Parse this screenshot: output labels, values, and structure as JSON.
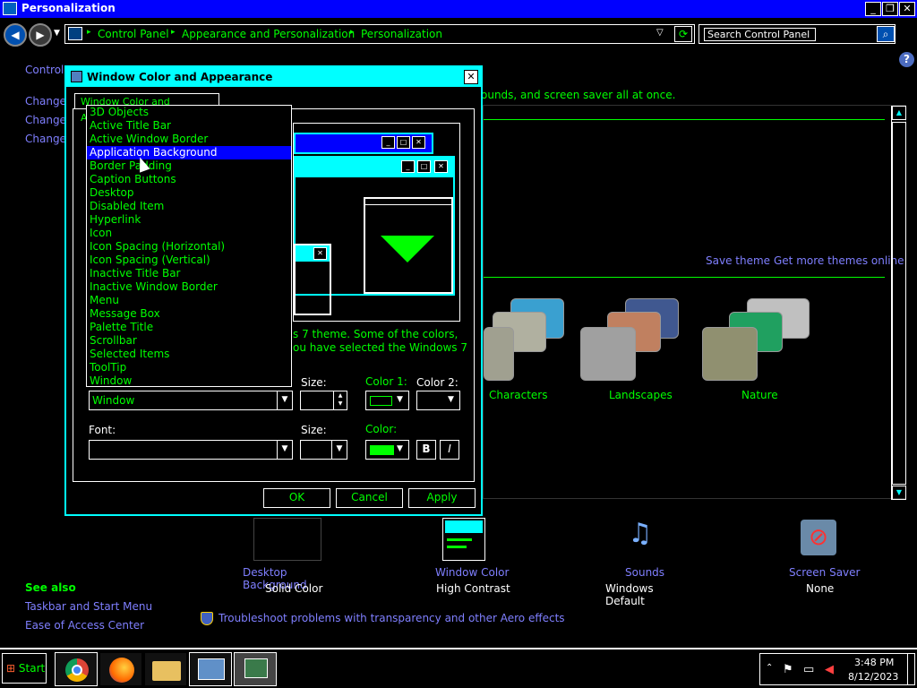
{
  "window": {
    "title": "Personalization"
  },
  "address": {
    "crumbs": [
      "Control Panel",
      "Appearance and Personalization",
      "Personalization"
    ],
    "search_placeholder": "Search Control Panel"
  },
  "left_nav": {
    "control_panel_home": "Control P",
    "items": [
      "Change d",
      "Change m",
      "Change y"
    ]
  },
  "header_text": "ounds, and screen saver all at once.",
  "theme_links": {
    "save": "Save theme",
    "more": "Get more themes online"
  },
  "themes": [
    "Characters",
    "Landscapes",
    "Nature"
  ],
  "bottom_items": [
    {
      "title": "Desktop Background",
      "subtitle": "Solid Color"
    },
    {
      "title": "Window Color",
      "subtitle": "High Contrast"
    },
    {
      "title": "Sounds",
      "subtitle": "Windows Default"
    },
    {
      "title": "Screen Saver",
      "subtitle": "None"
    }
  ],
  "see_also": {
    "heading": "See also",
    "links": [
      "Taskbar and Start Menu",
      "Ease of Access Center"
    ]
  },
  "troubleshoot": "Troubleshoot problems with transparency and other Aero effects",
  "dialog": {
    "title": "Window Color and Appearance",
    "tab": "Window Color and Appearance",
    "info_line1": "s 7 theme.  Some of the colors,",
    "info_line2": "ou have selected the Windows 7",
    "item_label_size": "Size:",
    "color1_label": "Color 1:",
    "color2_label": "Color 2:",
    "item_value": "Window",
    "font_label": "Font:",
    "font_size_label": "Size:",
    "font_color_label": "Color:",
    "bold_label": "B",
    "italic_label": "I",
    "ok": "OK",
    "cancel": "Cancel",
    "apply": "Apply",
    "dropdown_items": [
      "3D Objects",
      "Active Title Bar",
      "Active Window Border",
      "Application Background",
      "Border Padding",
      "Caption Buttons",
      "Desktop",
      "Disabled Item",
      "Hyperlink",
      "Icon",
      "Icon Spacing (Horizontal)",
      "Icon Spacing (Vertical)",
      "Inactive Title Bar",
      "Inactive Window Border",
      "Menu",
      "Message Box",
      "Palette Title",
      "Scrollbar",
      "Selected Items",
      "ToolTip",
      "Window"
    ],
    "selected_index": 3
  },
  "taskbar": {
    "start": "Start",
    "time": "3:48 PM",
    "date": "8/12/2023"
  },
  "colors": {
    "accent_cyan": "#00ffff",
    "link_green": "#00ff00",
    "selection_blue": "#0000ff",
    "link_blue": "#7f7fff"
  }
}
